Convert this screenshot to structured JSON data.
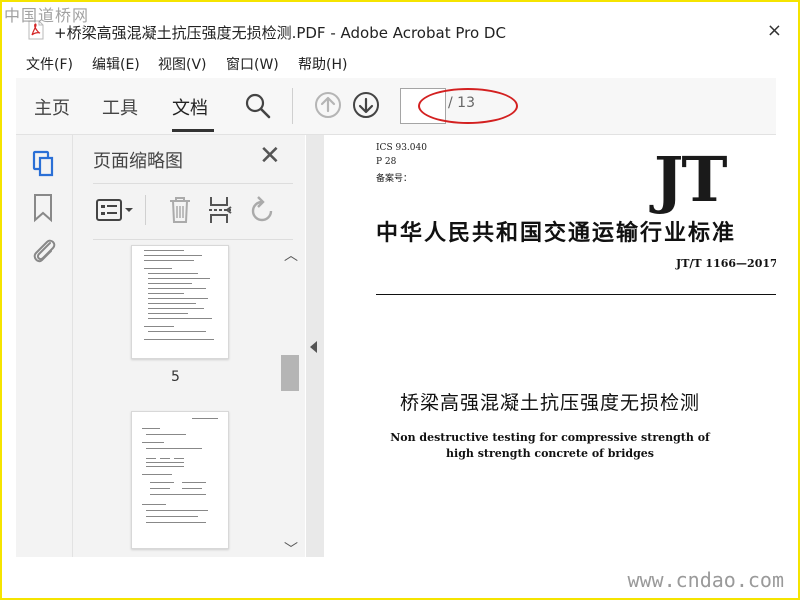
{
  "watermarks": {
    "top": "中国道桥网",
    "bottom": "www.cndao.com"
  },
  "window": {
    "title": "+桥梁高强混凝土抗压强度无损检测.PDF - Adobe Acrobat Pro DC",
    "close_glyph": "×"
  },
  "menu": {
    "items": [
      {
        "label": "文件(F)"
      },
      {
        "label": "编辑(E)"
      },
      {
        "label": "视图(V)"
      },
      {
        "label": "窗口(W)"
      },
      {
        "label": "帮助(H)"
      }
    ]
  },
  "toolbar": {
    "tabs": [
      {
        "label": "主页"
      },
      {
        "label": "工具"
      },
      {
        "label": "文档"
      }
    ],
    "active_tab": "文档",
    "page_input_value": "",
    "page_total": "/ 13"
  },
  "thumbnail_panel": {
    "title": "页面缩略图",
    "close_glyph": "✕",
    "thumbnails": [
      {
        "page_label": "5"
      },
      {
        "page_label": ""
      }
    ]
  },
  "document": {
    "ics": "ICS 93.040",
    "p": "P 28",
    "filing": "备案号：",
    "logo": "JT",
    "org": "中华人民共和国交通运输行业标准",
    "standard_number": "JT/T 1166—2017",
    "title_cn": "桥梁高强混凝土抗压强度无损检测",
    "title_en_line1": "Non destructive testing for compressive strength of",
    "title_en_line2": "high strength concrete of bridges"
  },
  "colors": {
    "accent_blue": "#2a6fd6",
    "highlight_red": "#d32020",
    "frame_yellow": "#f5e400"
  }
}
